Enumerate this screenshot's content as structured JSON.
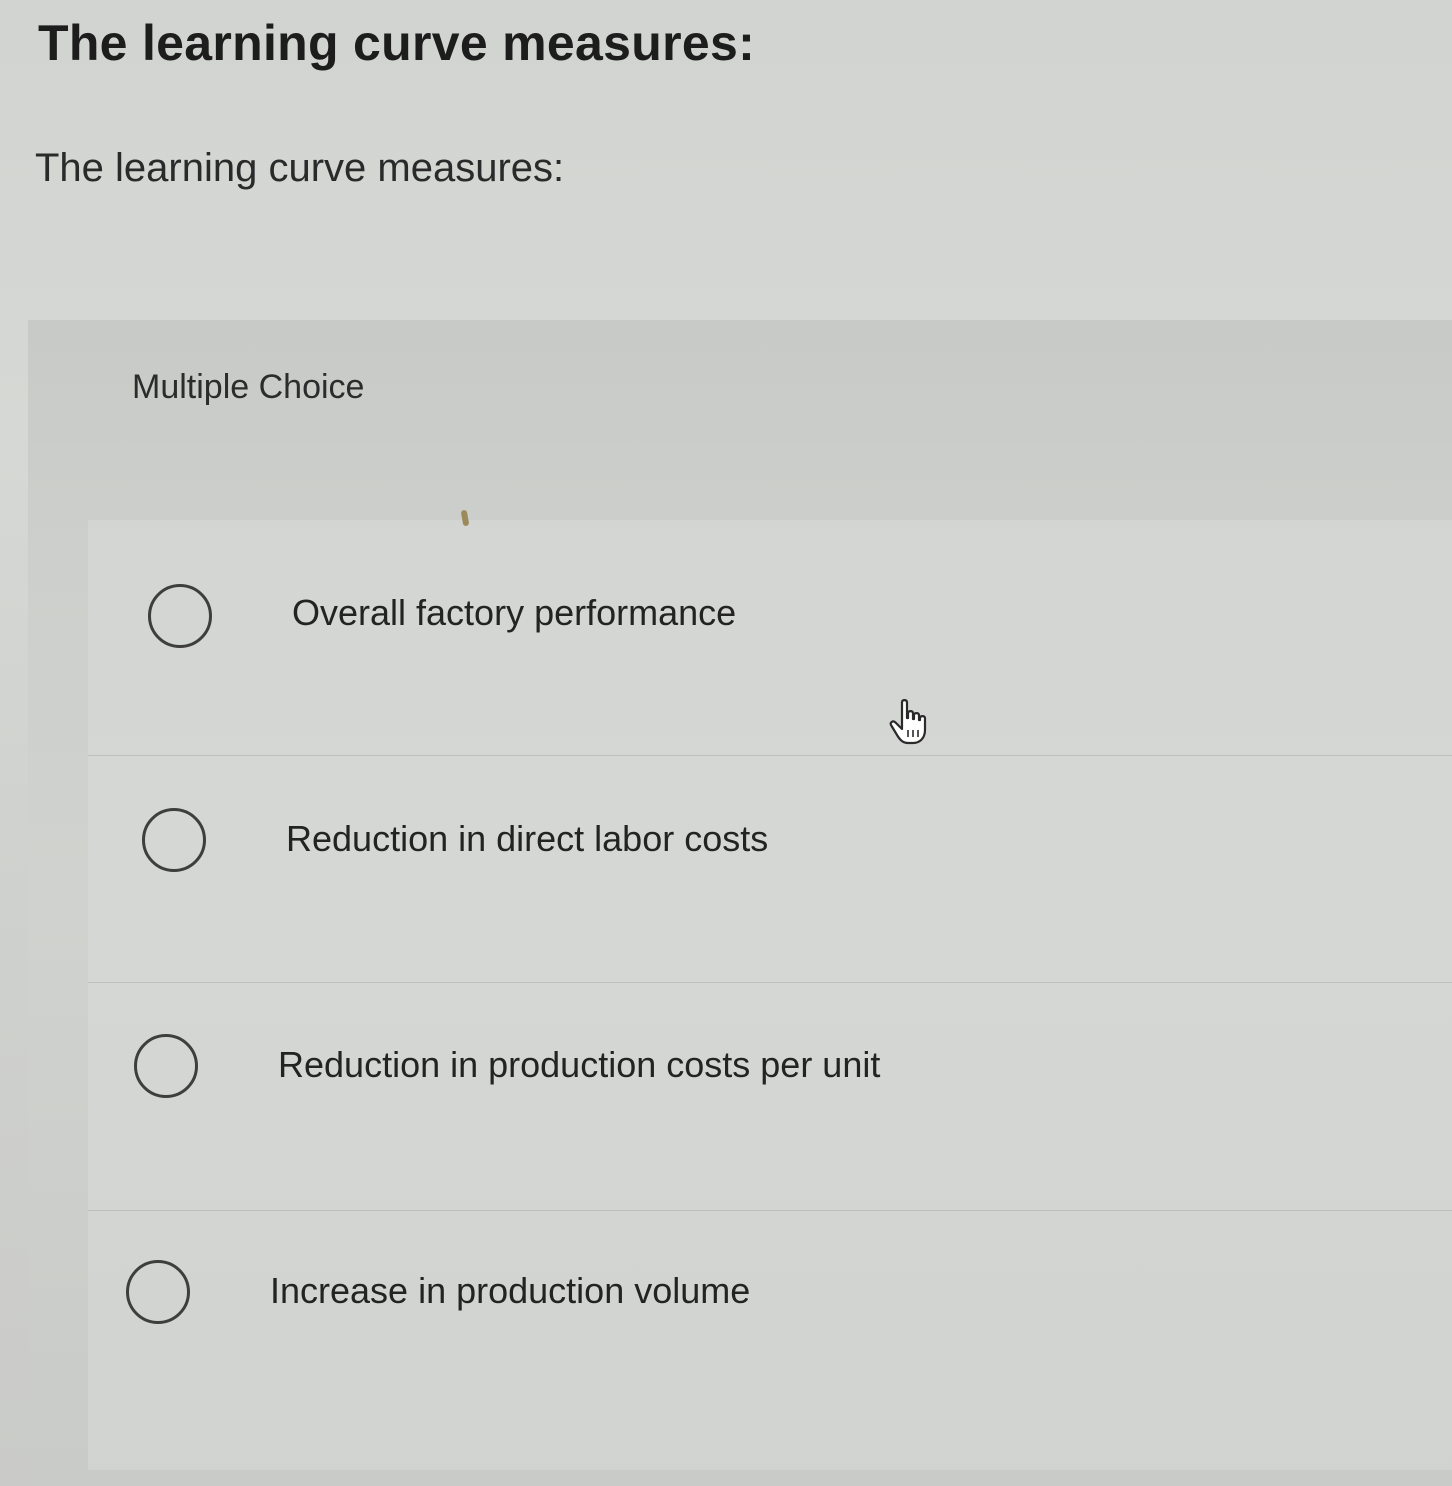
{
  "page": {
    "title": "The learning curve measures:",
    "question": "The learning curve measures:"
  },
  "question_panel": {
    "type_label": "Multiple Choice",
    "options": [
      {
        "label": "Overall factory performance",
        "selected": false
      },
      {
        "label": "Reduction in direct labor costs",
        "selected": false
      },
      {
        "label": "Reduction in production costs per unit",
        "selected": false
      },
      {
        "label": "Increase in production volume",
        "selected": false
      }
    ]
  },
  "cursor": {
    "icon": "hand-pointer-icon"
  }
}
